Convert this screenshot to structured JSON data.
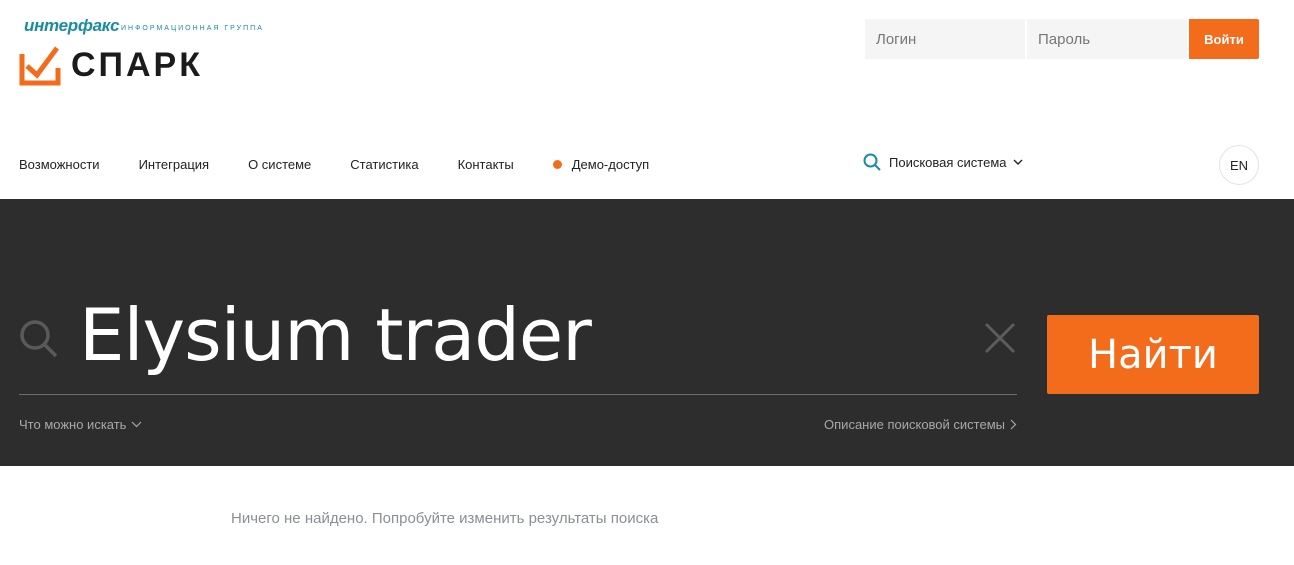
{
  "brand": {
    "interfax": "интерфакс",
    "group": "информационная группа",
    "name": "СПАРК",
    "accent_color": "#f36c1c",
    "teal_color": "#1a8ca0"
  },
  "auth": {
    "login_placeholder": "Логин",
    "password_placeholder": "Пароль",
    "submit_label": "Войти"
  },
  "nav": {
    "items": [
      {
        "label": "Возможности"
      },
      {
        "label": "Интеграция"
      },
      {
        "label": "О системе"
      },
      {
        "label": "Статистика"
      },
      {
        "label": "Контакты"
      },
      {
        "label": "Демо-доступ"
      }
    ],
    "search_system_label": "Поисковая система",
    "lang_label": "EN"
  },
  "hero": {
    "query": "Elysium trader",
    "search_button": "Найти",
    "what_to_search": "Что можно искать",
    "search_description": "Описание поисковой системы"
  },
  "results": {
    "empty_message": "Ничего не найдено. Попробуйте изменить результаты поиска"
  }
}
